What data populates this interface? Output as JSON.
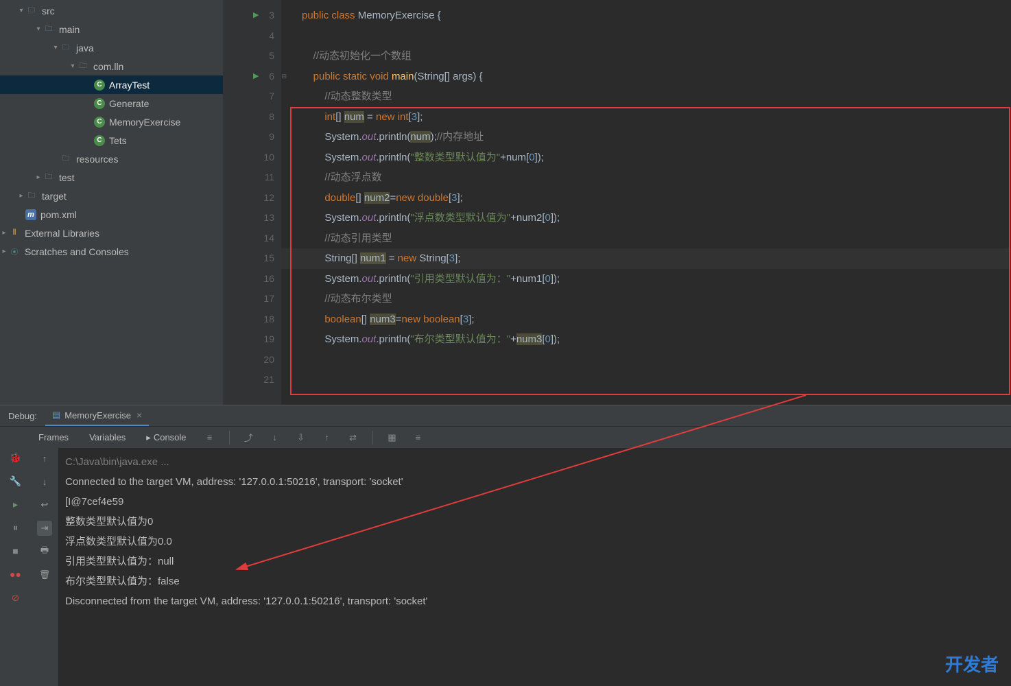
{
  "tree": {
    "src": "src",
    "main": "main",
    "java": "java",
    "pkg": "com.lln",
    "files": [
      "ArrayTest",
      "Generate",
      "MemoryExercise",
      "Tets"
    ],
    "resources": "resources",
    "test": "test",
    "target": "target",
    "pom": "pom.xml",
    "extlib": "External Libraries",
    "scratches": "Scratches and Consoles"
  },
  "editor": {
    "lines": [
      {
        "n": 3,
        "run": true,
        "html": "<span class='kw'>public</span> <span class='kw'>class</span> <span class='cls'>MemoryExercise</span> {"
      },
      {
        "n": 4,
        "html": ""
      },
      {
        "n": 5,
        "html": "    <span class='cmt'>//动态初始化一个数组</span>"
      },
      {
        "n": 6,
        "run": true,
        "fold": true,
        "html": "    <span class='kw'>public</span> <span class='kw'>static</span> <span class='kw'>void</span> <span class='mtd'>main</span>(String[] args) {"
      },
      {
        "n": 7,
        "html": "        <span class='cmt'>//动态整数类型</span>"
      },
      {
        "n": 8,
        "html": "        <span class='kw'>int</span>[] <span class='var-bg'>num</span> = <span class='kw'>new</span> <span class='kw'>int</span>[<span class='num'>3</span>];"
      },
      {
        "n": 9,
        "html": "        System.<span class='fld'>out</span>.println(<span class='var-bg'>num</span>);<span class='cmt'>//内存地址</span>"
      },
      {
        "n": 10,
        "html": "        System.<span class='fld'>out</span>.println(<span class='str'>\"整数类型默认值为\"</span>+num[<span class='num'>0</span>]);"
      },
      {
        "n": 11,
        "html": "        <span class='cmt'>//动态浮点数</span>"
      },
      {
        "n": 12,
        "html": "        <span class='kw'>double</span>[] <span class='var-bg'>num2</span>=<span class='kw'>new</span> <span class='kw'>double</span>[<span class='num'>3</span>];"
      },
      {
        "n": 13,
        "html": "        System.<span class='fld'>out</span>.println(<span class='str'>\"浮点数类型默认值为\"</span>+num2[<span class='num'>0</span>]);"
      },
      {
        "n": 14,
        "html": "        <span class='cmt'>//动态引用类型</span>"
      },
      {
        "n": 15,
        "current": true,
        "html": "        String[] <span class='var-bg'>num1</span> = <span class='kw'>new</span> String[<span class='num'>3</span>];"
      },
      {
        "n": 16,
        "html": "        System.<span class='fld'>out</span>.println(<span class='str'>\"引用类型默认值为：\"</span>+num1[<span class='num'>0</span>]);"
      },
      {
        "n": 17,
        "html": "        <span class='cmt'>//动态布尔类型</span>"
      },
      {
        "n": 18,
        "html": "        <span class='kw'>boolean</span>[] <span class='var-bg'>num3</span>=<span class='kw'>new</span> <span class='kw'>boolean</span>[<span class='num'>3</span>];"
      },
      {
        "n": 19,
        "html": "        System.<span class='fld'>out</span>.println(<span class='str'>\"布尔类型默认值为：\"</span>+<span class='var-bg'>num3</span>[<span class='num'>0</span>]);"
      },
      {
        "n": 20,
        "html": ""
      },
      {
        "n": 21,
        "html": ""
      }
    ]
  },
  "debug": {
    "label": "Debug:",
    "tab": "MemoryExercise",
    "tabs": {
      "frames": "Frames",
      "variables": "Variables",
      "console": "Console"
    }
  },
  "console": [
    {
      "cls": "sys",
      "text": "C:\\Java\\bin\\java.exe ..."
    },
    {
      "cls": "",
      "text": "Connected to the target VM, address: '127.0.0.1:50216', transport: 'socket'"
    },
    {
      "cls": "",
      "text": "[I@7cef4e59"
    },
    {
      "cls": "",
      "text": "整数类型默认值为0"
    },
    {
      "cls": "",
      "text": "浮点数类型默认值为0.0"
    },
    {
      "cls": "",
      "text": "引用类型默认值为：null"
    },
    {
      "cls": "",
      "text": "布尔类型默认值为：false"
    },
    {
      "cls": "",
      "text": "Disconnected from the target VM, address: '127.0.0.1:50216', transport: 'socket'"
    }
  ],
  "watermark": "开发者"
}
